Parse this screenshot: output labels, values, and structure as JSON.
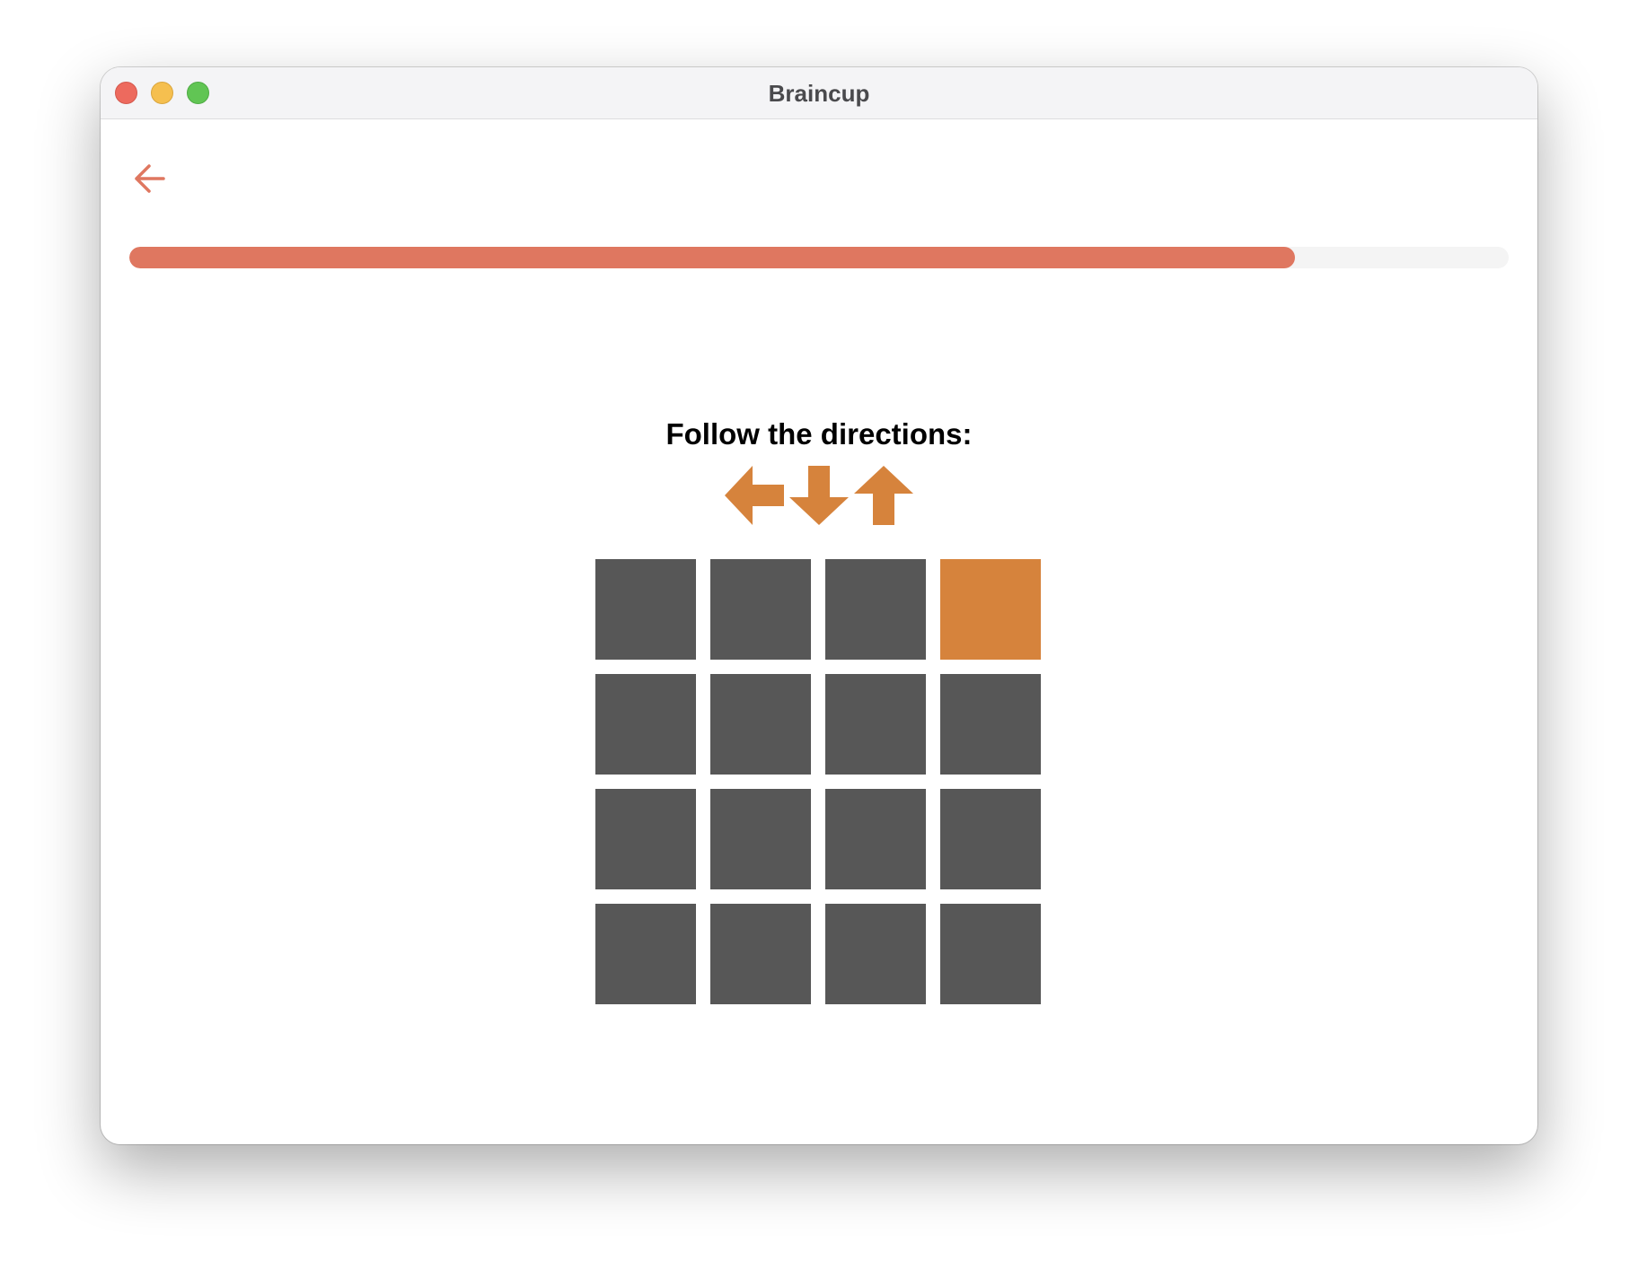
{
  "window": {
    "title": "Braincup"
  },
  "colors": {
    "accent": "#df7760",
    "arrow": "#d6833c",
    "cell": "#575757",
    "cell_active": "#d6833c",
    "track": "#f4f4f4"
  },
  "icons": {
    "back": "arrow-left-icon"
  },
  "progress": {
    "fraction": 0.845
  },
  "game": {
    "instruction": "Follow the directions:",
    "directions": [
      "left",
      "down",
      "up"
    ],
    "grid": {
      "rows": 4,
      "cols": 4,
      "active_row": 0,
      "active_col": 3
    }
  }
}
